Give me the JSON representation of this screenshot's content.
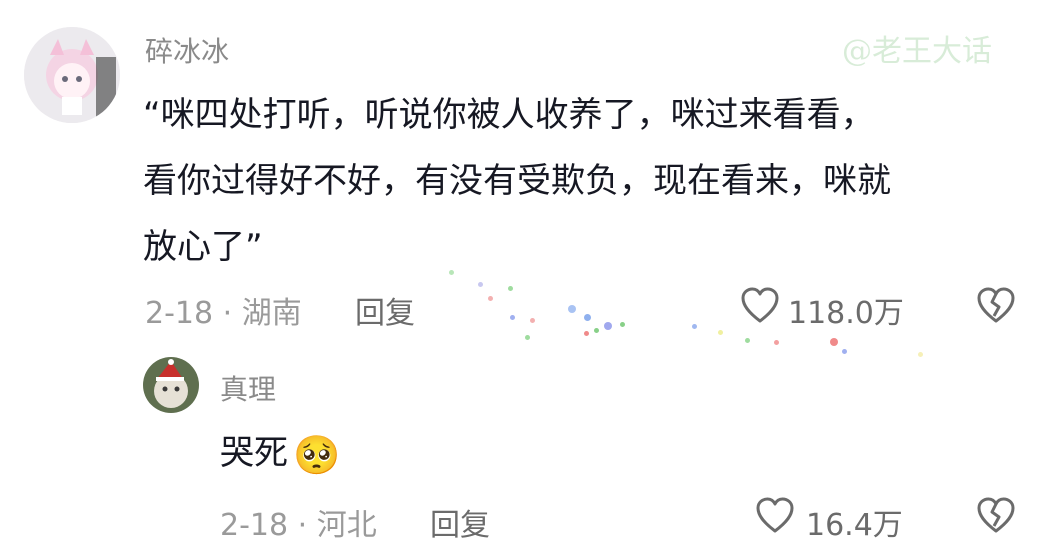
{
  "watermark": "@老王大话",
  "comments": [
    {
      "username": "碎冰冰",
      "text_lines": [
        "“咪四处打听，听说你被人收养了，咪过来看看，",
        "看你过得好不好，有没有受欺负，现在看来，咪就",
        "放心了”"
      ],
      "date_location": "2-18 · 湖南",
      "reply_label": "回复",
      "like_count": "118.0万",
      "like_icon": "heart-outline-icon",
      "dislike_icon": "broken-heart-icon"
    },
    {
      "username": "真理",
      "text": "哭死",
      "emoji": "🥺",
      "date_location": "2-18 · 河北",
      "reply_label": "回复",
      "like_count": "16.4万",
      "like_icon": "heart-outline-icon",
      "dislike_icon": "broken-heart-icon"
    }
  ],
  "colors": {
    "text": "#161823",
    "meta": "#9a9a9a",
    "username": "#8a8a8a",
    "icon": "#6b6b6b"
  }
}
